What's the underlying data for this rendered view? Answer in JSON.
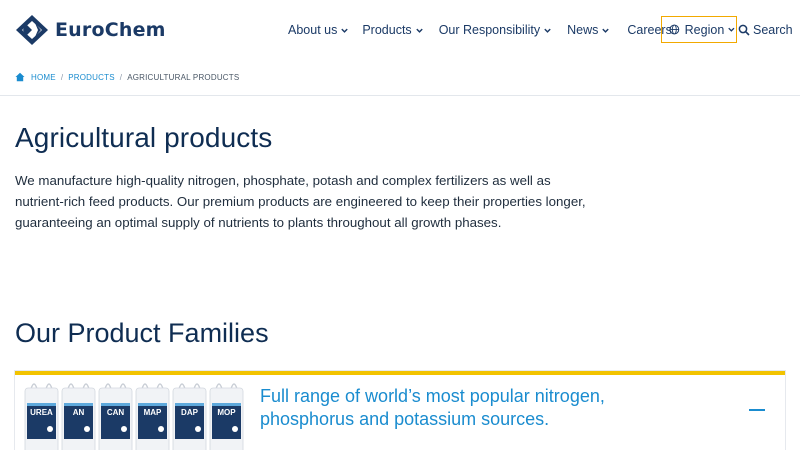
{
  "brand": {
    "name": "EuroChem"
  },
  "nav": {
    "items": [
      {
        "label": "About us",
        "has_dropdown": true
      },
      {
        "label": "Products",
        "has_dropdown": true
      },
      {
        "label": "Our Responsibility",
        "has_dropdown": true
      },
      {
        "label": "News",
        "has_dropdown": true
      },
      {
        "label": "Careers",
        "has_dropdown": false
      }
    ],
    "region_label": "Region",
    "search_label": "Search"
  },
  "breadcrumb": {
    "home": "HOME",
    "products": "PRODUCTS",
    "current": "AGRICULTURAL PRODUCTS"
  },
  "main": {
    "title": "Agricultural products",
    "intro": "We manufacture high-quality nitrogen, phosphate, potash and complex fertilizers as well as nutrient-rich feed products. Our premium products are engineered to keep their properties longer, guaranteeing an optimal supply of nutrients to plants throughout all growth phases."
  },
  "families": {
    "title": "Our Product Families",
    "card": {
      "text": "Full range of world’s most popular nitrogen, phosphorus and potassium sources.",
      "bags": [
        "UREA",
        "AN",
        "CAN",
        "MAP",
        "DAP",
        "MOP"
      ]
    }
  },
  "colors": {
    "accent": "#1a8ccf",
    "navy": "#1b3a66",
    "highlight": "#f2a900",
    "card_border": "#f2c300"
  }
}
